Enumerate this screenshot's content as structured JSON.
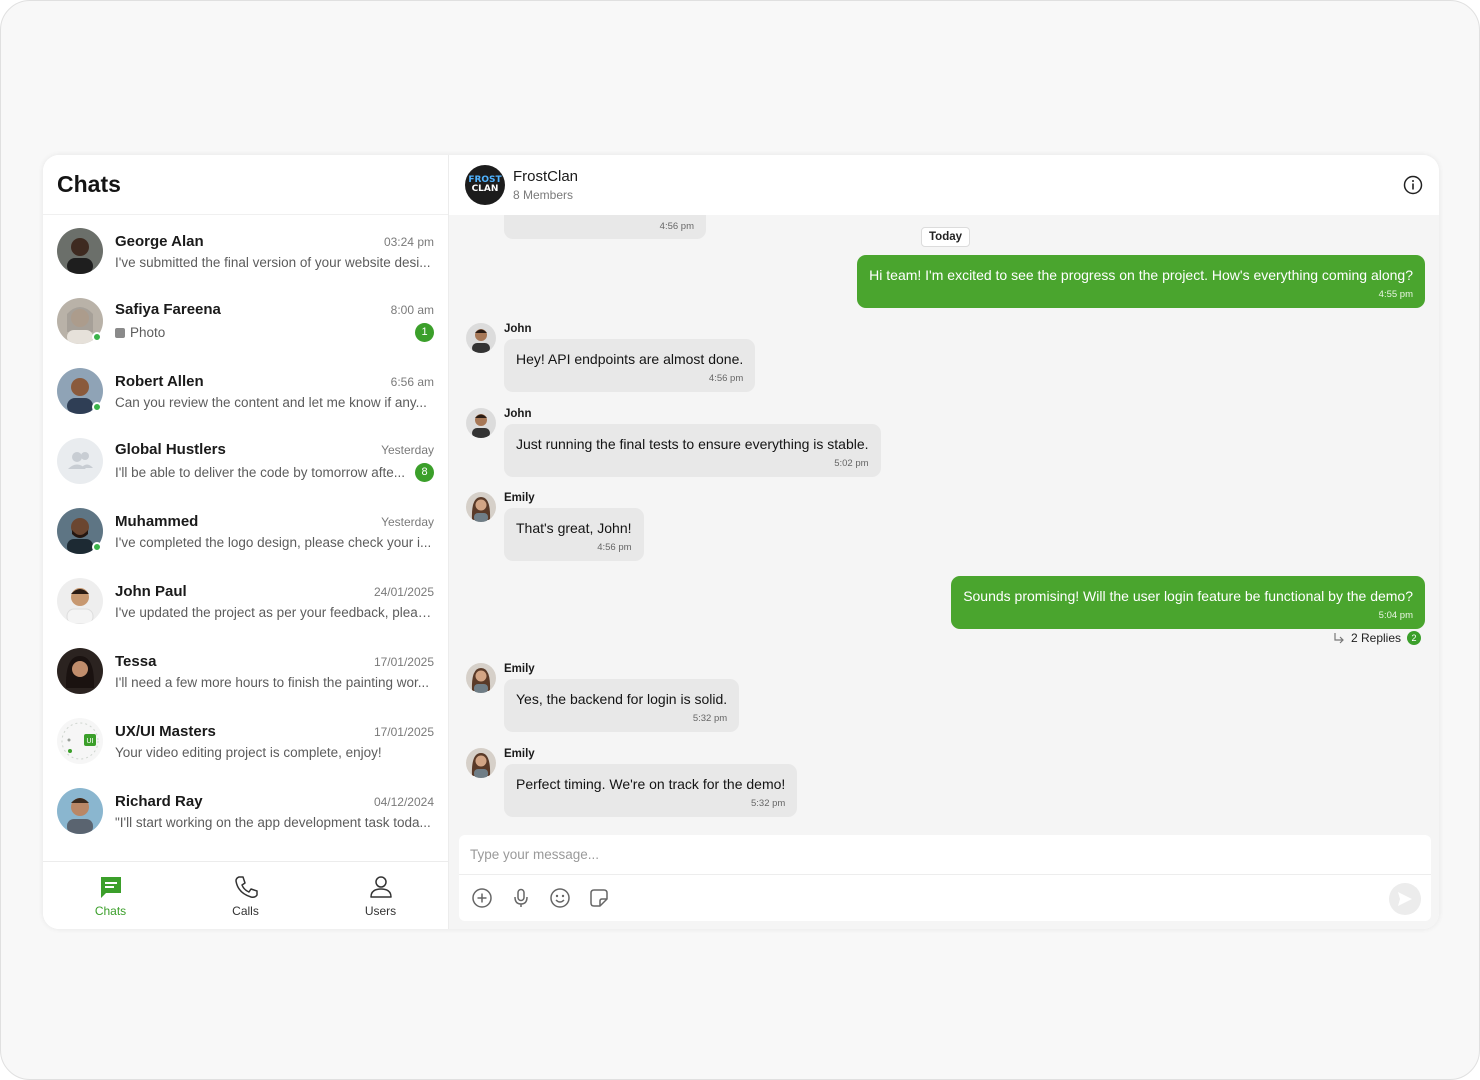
{
  "sidebar": {
    "title": "Chats",
    "chats": [
      {
        "name": "George Alan",
        "time": "03:24 pm",
        "preview": "I've submitted the final version of your website desi...",
        "online": false,
        "badge": ""
      },
      {
        "name": "Safiya Fareena",
        "time": "8:00 am",
        "preview": "Photo",
        "online": true,
        "badge": "1"
      },
      {
        "name": "Robert Allen",
        "time": "6:56 am",
        "preview": "Can you review the content and let me know if any...",
        "online": true,
        "badge": ""
      },
      {
        "name": "Global Hustlers",
        "time": "Yesterday",
        "preview": "I'll be able to deliver the code by tomorrow afte...",
        "online": false,
        "badge": "8"
      },
      {
        "name": "Muhammed",
        "time": "Yesterday",
        "preview": "I've completed the logo design, please check your i...",
        "online": true,
        "badge": ""
      },
      {
        "name": "John Paul",
        "time": "24/01/2025",
        "preview": "I've updated the project as per your feedback, pleas...",
        "online": false,
        "badge": ""
      },
      {
        "name": "Tessa",
        "time": "17/01/2025",
        "preview": "I'll need a few more hours to finish the painting wor...",
        "online": false,
        "badge": ""
      },
      {
        "name": "UX/UI Masters",
        "time": "17/01/2025",
        "preview": "Your video editing project is complete, enjoy!",
        "online": false,
        "badge": ""
      },
      {
        "name": "Richard Ray",
        "time": "04/12/2024",
        "preview": "\"I'll start working on the app development task toda...",
        "online": false,
        "badge": ""
      }
    ],
    "nav": {
      "chats": "Chats",
      "calls": "Calls",
      "users": "Users"
    }
  },
  "conversation": {
    "group_name": "FrostClan",
    "members": "8 Members",
    "logo_line1": "FROST",
    "logo_line2": "CLAN",
    "top_time": "4:56 pm",
    "date_chip": "Today",
    "messages": [
      {
        "sender": "",
        "text": "Hi team! I'm excited to see the progress on the project. How's everything coming along?",
        "time": "4:55 pm",
        "out": true
      },
      {
        "sender": "John",
        "text": "Hey! API endpoints are almost done.",
        "time": "4:56 pm",
        "out": false
      },
      {
        "sender": "John",
        "text": "Just running the final tests to ensure everything is stable.",
        "time": "5:02 pm",
        "out": false
      },
      {
        "sender": "Emily",
        "text": "That's great, John!",
        "time": "4:56 pm",
        "out": false
      },
      {
        "sender": "",
        "text": "Sounds promising! Will the user login feature be functional by the demo?",
        "time": "5:04 pm",
        "out": true
      },
      {
        "sender": "Emily",
        "text": "Yes, the backend for login is solid.",
        "time": "5:32 pm",
        "out": false
      },
      {
        "sender": "Emily",
        "text": "Perfect timing. We're on track for the demo!",
        "time": "5:32 pm",
        "out": false
      }
    ],
    "replies_label": "2 Replies",
    "replies_count": "2",
    "composer_placeholder": "Type your message..."
  },
  "colors": {
    "accent": "#4aa52e",
    "badge": "#3b9f2a",
    "online": "#3bb34a"
  },
  "icons": [
    "chat-icon",
    "phone-icon",
    "user-icon",
    "info-icon",
    "plus-circle-icon",
    "mic-icon",
    "emoji-icon",
    "sticker-icon",
    "send-icon"
  ]
}
